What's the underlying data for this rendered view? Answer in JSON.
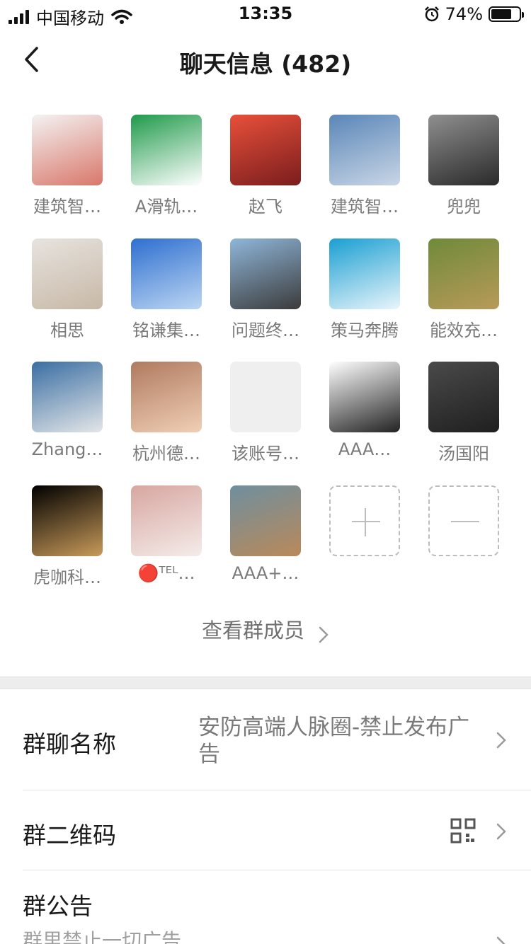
{
  "status_bar": {
    "carrier": "中国移动",
    "time": "13:35",
    "battery_percent": "74%",
    "battery_level": 0.74
  },
  "nav": {
    "title": "聊天信息 (482)",
    "back_icon": "chevron-left-icon"
  },
  "members": [
    {
      "name": "建筑智…",
      "avatar_colors": [
        "#f3f3f3",
        "#d9776a"
      ]
    },
    {
      "name": "A滑轨…",
      "avatar_colors": [
        "#1f9a4a",
        "#ffffff"
      ]
    },
    {
      "name": "赵飞",
      "avatar_colors": [
        "#e8503a",
        "#7a1d1d"
      ]
    },
    {
      "name": "建筑智…",
      "avatar_colors": [
        "#5a86b8",
        "#c9d6e6"
      ]
    },
    {
      "name": "兜兜",
      "avatar_colors": [
        "#8f8f8f",
        "#2a2a2a"
      ]
    },
    {
      "name": "相思",
      "avatar_colors": [
        "#e7e3df",
        "#c7b8a6"
      ]
    },
    {
      "name": "铭谦集…",
      "avatar_colors": [
        "#2e6fd0",
        "#bcd6f3"
      ]
    },
    {
      "name": "问题终…",
      "avatar_colors": [
        "#8fb6d9",
        "#3b3b3b"
      ]
    },
    {
      "name": "策马奔腾",
      "avatar_colors": [
        "#1a9fd2",
        "#e9f5fb"
      ]
    },
    {
      "name": "能效充…",
      "avatar_colors": [
        "#6f8a3a",
        "#b89a5a"
      ]
    },
    {
      "name": "Zhang…",
      "avatar_colors": [
        "#3a6ea3",
        "#e3e6e8"
      ]
    },
    {
      "name": "杭州德…",
      "avatar_colors": [
        "#b07a60",
        "#f0cfb5"
      ]
    },
    {
      "name": "该账号…",
      "avatar_colors": [
        "#efefef",
        "#efefef"
      ]
    },
    {
      "name": "AAA…",
      "avatar_colors": [
        "#ffffff",
        "#222222"
      ]
    },
    {
      "name": "汤国阳",
      "avatar_colors": [
        "#4a4a4a",
        "#1f1f1f"
      ]
    },
    {
      "name": "虎咖科…",
      "avatar_colors": [
        "#000000",
        "#c89a5a"
      ]
    },
    {
      "name": "🔴ᵀᴱᴸ…",
      "avatar_colors": [
        "#d8a6a0",
        "#f4ecea"
      ]
    },
    {
      "name": "AAA+…",
      "avatar_colors": [
        "#6f8f9f",
        "#b9895a"
      ]
    }
  ],
  "grid_actions": {
    "add_icon": "plus-icon",
    "remove_icon": "minus-icon"
  },
  "view_members": {
    "label": "查看群成员"
  },
  "settings": {
    "group_name": {
      "label": "群聊名称",
      "value": "安防高端人脉圈-禁止发布广告"
    },
    "group_qr": {
      "label": "群二维码",
      "icon": "qr-code-icon"
    },
    "group_notice": {
      "label": "群公告",
      "value": "群里禁止一切广告"
    }
  }
}
